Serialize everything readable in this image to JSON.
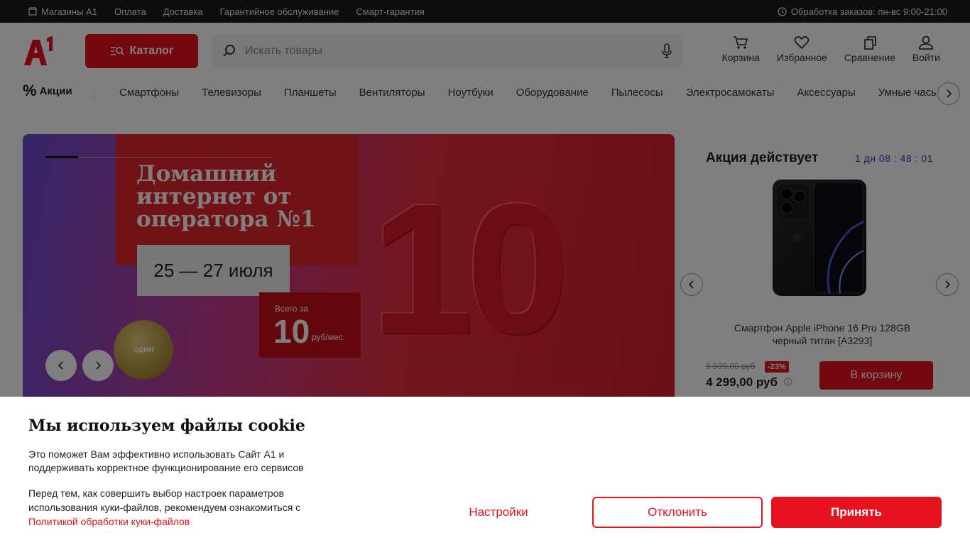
{
  "topbar": {
    "links": [
      "Магазины А1",
      "Оплата",
      "Доставка",
      "Гарантийное обслуживание",
      "Смарт-гарантия"
    ],
    "hours": "Обработка заказов: пн-вс 9:00-21:00"
  },
  "header": {
    "logo_text": "A1",
    "catalog_label": "Каталог",
    "search_placeholder": "Искать товары",
    "actions": [
      "Корзина",
      "Избранное",
      "Сравнение",
      "Войти"
    ]
  },
  "catnav": {
    "promo_label": "Акции",
    "items": [
      "Смартфоны",
      "Телевизоры",
      "Планшеты",
      "Вентиляторы",
      "Ноутбуки",
      "Оборудование",
      "Пылесосы",
      "Электросамокаты",
      "Аксессуары",
      "Умные часы"
    ]
  },
  "banner": {
    "title": "Домашний интернет от оператора №1",
    "dates": "25 — 27 июля",
    "price_label": "Всего за",
    "price_value": "10",
    "price_unit": "руб/мес",
    "big_number": "10",
    "medal_text": "ОДИН"
  },
  "promo_card": {
    "title": "Акция действует",
    "timer": "1 дн  08 : 48 : 01",
    "product_name": "Смартфон Apple iPhone 16 Pro 128GB черный титан [A3293]",
    "old_price": "5 599,00 руб",
    "discount": "-23%",
    "new_price": "4 299,00 руб",
    "cart_label": "В корзину"
  },
  "cookie": {
    "title": "Мы используем файлы cookie",
    "text1": "Это поможет Вам эффективно использовать Сайт А1 и поддерживать корректное функционирование его сервисов",
    "text2": "Перед тем, как совершить выбор настроек параметров использования куки-файлов, рекомендуем ознакомиться с",
    "policy_link": "Политикой обработки куки-файлов",
    "settings_label": "Настройки",
    "decline_label": "Отклонить",
    "accept_label": "Принять"
  },
  "colors": {
    "brand_red": "#e6121d",
    "timer_blue": "#2a35c8"
  }
}
